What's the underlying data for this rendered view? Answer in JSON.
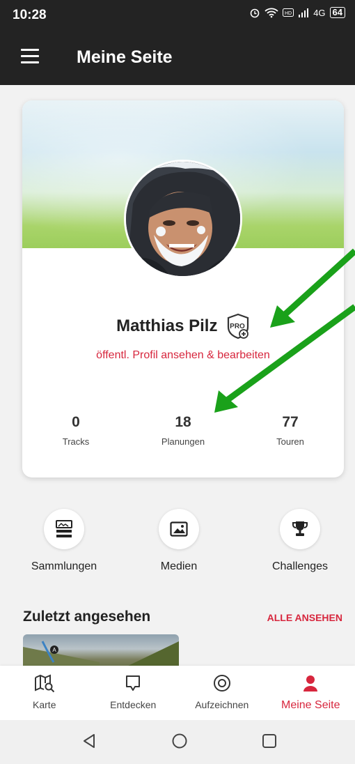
{
  "status_bar": {
    "time": "10:28",
    "battery": "64",
    "network": "4G"
  },
  "app_bar": {
    "title": "Meine Seite"
  },
  "profile": {
    "name": "Matthias Pilz",
    "profile_link": "öffentl. Profil ansehen & bearbeiten",
    "stats": [
      {
        "value": "0",
        "label": "Tracks"
      },
      {
        "value": "18",
        "label": "Planungen"
      },
      {
        "value": "77",
        "label": "Touren"
      }
    ]
  },
  "quick_actions": [
    {
      "label": "Sammlungen",
      "icon": "collections-icon"
    },
    {
      "label": "Medien",
      "icon": "image-icon"
    },
    {
      "label": "Challenges",
      "icon": "trophy-icon"
    }
  ],
  "recent": {
    "title": "Zuletzt angesehen",
    "all_link": "ALLE ANSEHEN"
  },
  "bottom_nav": [
    {
      "label": "Karte",
      "icon": "map-search-icon"
    },
    {
      "label": "Entdecken",
      "icon": "discover-icon"
    },
    {
      "label": "Aufzeichnen",
      "icon": "record-icon"
    },
    {
      "label": "Meine Seite",
      "icon": "person-icon",
      "active": true
    }
  ],
  "colors": {
    "accent": "#d7263d",
    "dark": "#232323",
    "arrow": "#1aa11a"
  }
}
